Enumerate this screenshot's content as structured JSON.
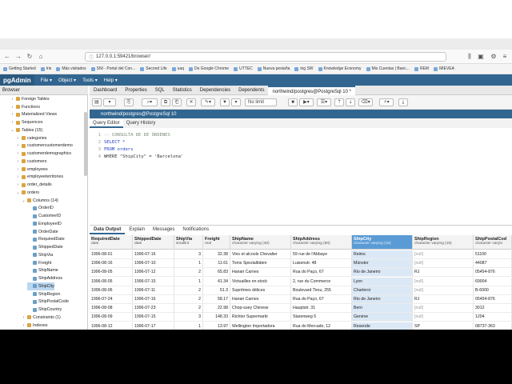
{
  "browser": {
    "url": "127.0.0.1:59421/browser/",
    "bookmarks": [
      "Getting Started",
      "Iris",
      "Más visitados",
      "SNI - Portal del Con...",
      "Second Life",
      "uaq",
      "De Google Chrome",
      "UTTEC",
      "Nueva pestaña",
      "ing SW",
      "Knowledge Economy",
      "Mis Cuentas | Banc...",
      "REM",
      "MIEVEA"
    ]
  },
  "app": {
    "logo": "pgAdmin",
    "menus": [
      "File ▾",
      "Object ▾",
      "Tools ▾",
      "Help ▾"
    ]
  },
  "tree": {
    "title": "Browser",
    "items": [
      {
        "label": "Foreign Tables",
        "indent": 1,
        "caret": "›",
        "icon": "table-icon"
      },
      {
        "label": "Functions",
        "indent": 1,
        "caret": "›",
        "icon": "function-icon"
      },
      {
        "label": "Materialized Views",
        "indent": 1,
        "caret": "›",
        "icon": "view-icon"
      },
      {
        "label": "Sequences",
        "indent": 1,
        "caret": "›",
        "icon": "sequence-icon"
      },
      {
        "label": "Tables (15)",
        "indent": 1,
        "caret": "⌄",
        "icon": "tables-icon"
      },
      {
        "label": "categories",
        "indent": 2,
        "caret": "›",
        "icon": "table-icon"
      },
      {
        "label": "customercustomerdemo",
        "indent": 2,
        "caret": "›",
        "icon": "table-icon"
      },
      {
        "label": "customerdemographics",
        "indent": 2,
        "caret": "›",
        "icon": "table-icon"
      },
      {
        "label": "customers",
        "indent": 2,
        "caret": "›",
        "icon": "table-icon"
      },
      {
        "label": "employees",
        "indent": 2,
        "caret": "›",
        "icon": "table-icon"
      },
      {
        "label": "employeeterritories",
        "indent": 2,
        "caret": "›",
        "icon": "table-icon"
      },
      {
        "label": "order_details",
        "indent": 2,
        "caret": "›",
        "icon": "table-icon"
      },
      {
        "label": "orders",
        "indent": 2,
        "caret": "⌄",
        "icon": "table-icon"
      },
      {
        "label": "Columns (14)",
        "indent": 3,
        "caret": "⌄",
        "icon": "columns-icon"
      },
      {
        "label": "OrderID",
        "indent": 4,
        "caret": "",
        "icon": "column-icon"
      },
      {
        "label": "CustomerID",
        "indent": 4,
        "caret": "",
        "icon": "column-icon"
      },
      {
        "label": "EmployeeID",
        "indent": 4,
        "caret": "",
        "icon": "column-icon"
      },
      {
        "label": "OrderDate",
        "indent": 4,
        "caret": "",
        "icon": "column-icon"
      },
      {
        "label": "RequiredDate",
        "indent": 4,
        "caret": "",
        "icon": "column-icon"
      },
      {
        "label": "ShippedDate",
        "indent": 4,
        "caret": "",
        "icon": "column-icon"
      },
      {
        "label": "ShipVia",
        "indent": 4,
        "caret": "",
        "icon": "column-icon"
      },
      {
        "label": "Freight",
        "indent": 4,
        "caret": "",
        "icon": "column-icon"
      },
      {
        "label": "ShipName",
        "indent": 4,
        "caret": "",
        "icon": "column-icon"
      },
      {
        "label": "ShipAddress",
        "indent": 4,
        "caret": "",
        "icon": "column-icon"
      },
      {
        "label": "ShipCity",
        "indent": 4,
        "caret": "",
        "icon": "column-icon",
        "selected": true
      },
      {
        "label": "ShipRegion",
        "indent": 4,
        "caret": "",
        "icon": "column-icon"
      },
      {
        "label": "ShipPostalCode",
        "indent": 4,
        "caret": "",
        "icon": "column-icon"
      },
      {
        "label": "ShipCountry",
        "indent": 4,
        "caret": "",
        "icon": "column-icon"
      },
      {
        "label": "Constraints (1)",
        "indent": 3,
        "caret": "›",
        "icon": "constraint-icon"
      },
      {
        "label": "Indexes",
        "indent": 3,
        "caret": "›",
        "icon": "index-icon"
      }
    ]
  },
  "main_tabs": [
    "Dashboard",
    "Properties",
    "SQL",
    "Statistics",
    "Dependencies",
    "Dependents",
    "northwind/postgres@PostgreSql 10 *"
  ],
  "toolbar": {
    "limit_label": "No limit"
  },
  "connection": "northwind/postgres@PostgreSql 10",
  "editor_tabs": [
    "Query Editor",
    "Query History"
  ],
  "editor": {
    "lines": [
      {
        "no": "1",
        "text": "-- CONSULTA DE DE ÓRDENES"
      },
      {
        "no": "2",
        "text": "SELECT *"
      },
      {
        "no": "3",
        "text": "FROM orders"
      },
      {
        "no": "4",
        "text": "WHERE \"ShipCity\" = 'Barcelona'"
      }
    ]
  },
  "result_tabs": [
    "Data Output",
    "Explain",
    "Messages",
    "Notifications"
  ],
  "grid": {
    "columns": [
      {
        "name": "RequiredDate",
        "type": "date"
      },
      {
        "name": "ShippedDate",
        "type": "date"
      },
      {
        "name": "ShipVia",
        "type": "smallint"
      },
      {
        "name": "Freight",
        "type": "real"
      },
      {
        "name": "ShipName",
        "type": "character varying (40)"
      },
      {
        "name": "ShipAddress",
        "type": "character varying (60)"
      },
      {
        "name": "ShipCity",
        "type": "character varying (15)"
      },
      {
        "name": "ShipRegion",
        "type": "character varying (15)"
      },
      {
        "name": "ShipPostalCod",
        "type": "character varyin"
      }
    ],
    "rows": [
      [
        "1996-08-01",
        "1996-07-16",
        "3",
        "32.38",
        "Vins et alcools Chevalier",
        "59 rue de l'Abbaye",
        "Reims",
        "[null]",
        "51100"
      ],
      [
        "1996-08-16",
        "1996-07-10",
        "1",
        "11.61",
        "Toms Spezialitäten",
        "Luisenstr. 48",
        "Münster",
        "[null]",
        "44087"
      ],
      [
        "1996-08-05",
        "1996-07-12",
        "2",
        "65.83",
        "Hanari Carnes",
        "Rua do Paço, 67",
        "Rio de Janeiro",
        "RJ",
        "05454-876"
      ],
      [
        "1996-08-05",
        "1996-07-15",
        "1",
        "41.34",
        "Victuailles en stock",
        "2, rue du Commerce",
        "Lyon",
        "[null]",
        "69004"
      ],
      [
        "1996-08-06",
        "1996-07-11",
        "2",
        "51.3",
        "Suprêmes délices",
        "Boulevard Tirou, 255",
        "Charleroi",
        "[null]",
        "B-6000"
      ],
      [
        "1996-07-24",
        "1996-07-16",
        "2",
        "58.17",
        "Hanari Carnes",
        "Rua do Paço, 67",
        "Rio de Janeiro",
        "RJ",
        "05454-876"
      ],
      [
        "1996-08-08",
        "1996-07-23",
        "2",
        "22.98",
        "Chop-suey Chinese",
        "Hauptstr. 31",
        "Bern",
        "[null]",
        "3012"
      ],
      [
        "1996-08-09",
        "1996-07-15",
        "3",
        "148.33",
        "Richter Supermarkt",
        "Starenweg 5",
        "Genève",
        "[null]",
        "1204"
      ],
      [
        "1996-08-12",
        "1996-07-17",
        "1",
        "13.97",
        "Wellington Importadora",
        "Rua do Mercado, 12",
        "Resende",
        "SP",
        "08737-363"
      ]
    ]
  }
}
